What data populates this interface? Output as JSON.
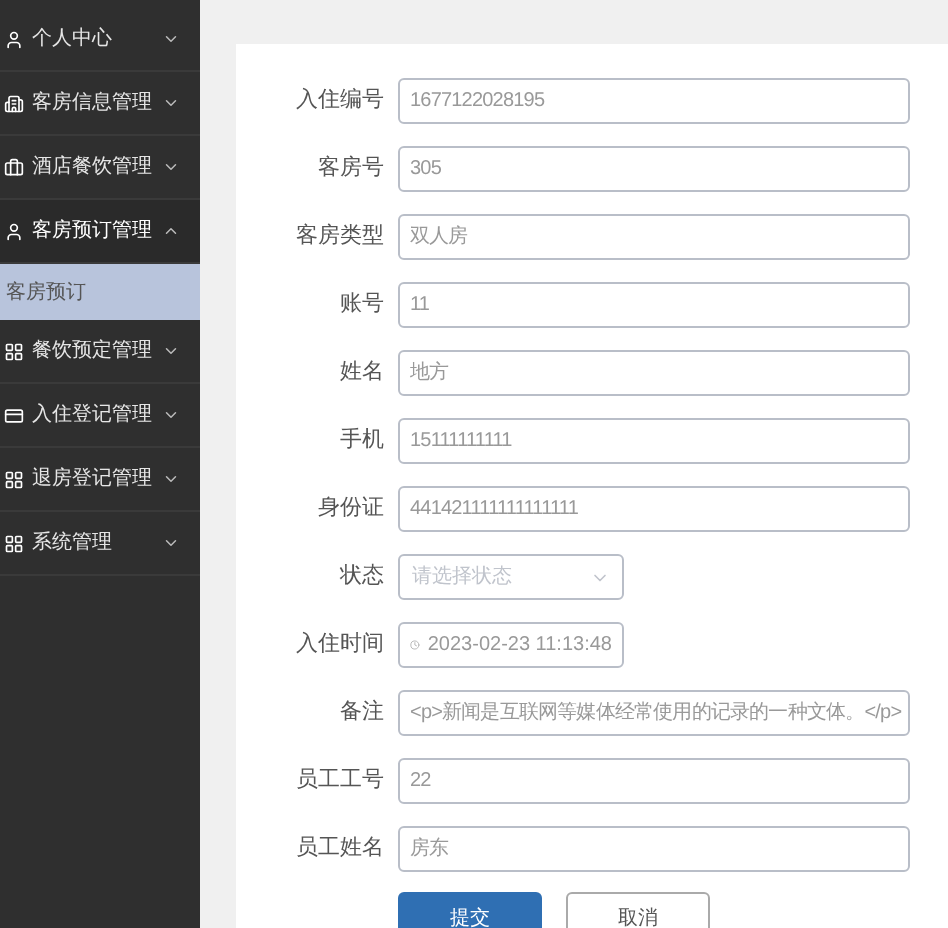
{
  "sidebar": {
    "items": [
      {
        "label": "个人中心",
        "expanded": false
      },
      {
        "label": "客房信息管理",
        "expanded": false
      },
      {
        "label": "酒店餐饮管理",
        "expanded": false
      },
      {
        "label": "客房预订管理",
        "expanded": true,
        "children": [
          {
            "label": "客房预订",
            "selected": true
          }
        ]
      },
      {
        "label": "餐饮预定管理",
        "expanded": false
      },
      {
        "label": "入住登记管理",
        "expanded": false
      },
      {
        "label": "退房登记管理",
        "expanded": false
      },
      {
        "label": "系统管理",
        "expanded": false
      }
    ]
  },
  "form": {
    "fields": [
      {
        "kind": "input",
        "label": "入住编号",
        "value": "1677122028195"
      },
      {
        "kind": "input",
        "label": "客房号",
        "value": "305"
      },
      {
        "kind": "input",
        "label": "客房类型",
        "value": "双人房"
      },
      {
        "kind": "input",
        "label": "账号",
        "value": "11"
      },
      {
        "kind": "input",
        "label": "姓名",
        "value": "地方"
      },
      {
        "kind": "input",
        "label": "手机",
        "value": "15111111111"
      },
      {
        "kind": "input",
        "label": "身份证",
        "value": "441421111111111111"
      },
      {
        "kind": "select",
        "label": "状态",
        "placeholder": "请选择状态"
      },
      {
        "kind": "date",
        "label": "入住时间",
        "value": "2023-02-23 11:13:48"
      },
      {
        "kind": "input",
        "label": "备注",
        "value": "<p>新闻是互联网等媒体经常使用的记录的一种文体。</p>"
      },
      {
        "kind": "input",
        "label": "员工工号",
        "value": "22"
      },
      {
        "kind": "input",
        "label": "员工姓名",
        "value": "房东"
      }
    ],
    "buttons": [
      {
        "kind": "primary",
        "label": "提交"
      },
      {
        "kind": "default",
        "label": "取消"
      }
    ]
  }
}
